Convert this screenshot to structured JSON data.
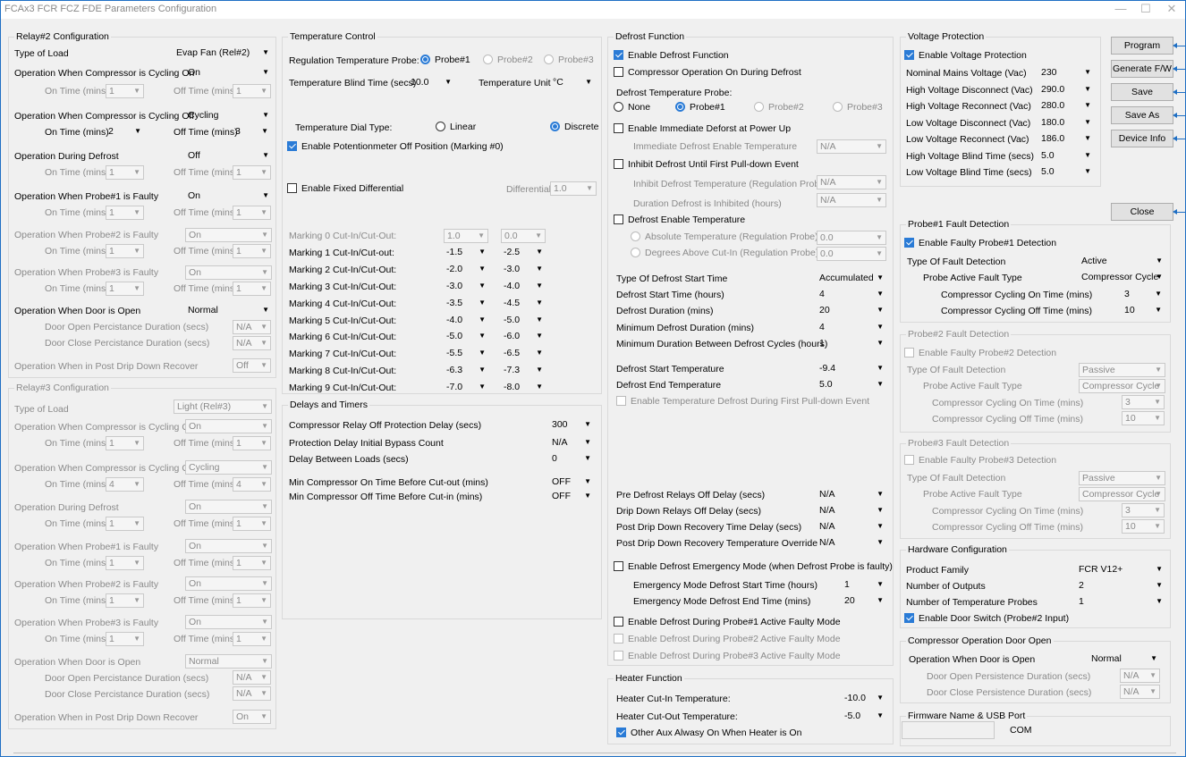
{
  "window": {
    "title": "FCAx3 FCR FCZ FDE Parameters Configuration",
    "min": "—",
    "max": "☐",
    "close": "✕"
  },
  "relay2": {
    "title": "Relay#2 Configuration",
    "type_label": "Type of Load",
    "type_value": "Evap Fan (Rel#2)",
    "cyc_on_label": "Operation When Compressor is Cycling On",
    "cyc_on_value": "On",
    "on_time": "On Time (mins)",
    "off_time": "Off Time (mins)",
    "one": "1",
    "two": "2",
    "three": "3",
    "cyc_off_label": "Operation When Compressor is Cycling Off",
    "cyc_off_value": "Cycling",
    "defrost_label": "Operation During Defrost",
    "defrost_value": "Off",
    "p1_label": "Operation When Probe#1 is Faulty",
    "p1_value": "On",
    "p2_label": "Operation When Probe#2 is Faulty",
    "p2_value": "On",
    "p3_label": "Operation When Probe#3 is Faulty",
    "p3_value": "On",
    "door_label": "Operation When Door is Open",
    "door_value": "Normal",
    "door_open_label": "Door Open Percistance Duration (secs)",
    "door_close_label": "Door Close Percistance Duration (secs)",
    "na": "N/A",
    "postdrip_label": "Operation When in Post Drip Down Recover",
    "postdrip_value": "Off"
  },
  "relay3": {
    "title": "Relay#3 Configuration",
    "type_label": "Type of Load",
    "type_value": "Light (Rel#3)",
    "cyc_on_label": "Operation When Compressor is Cycling On",
    "cyc_on_value": "On",
    "on_time": "On Time (mins)",
    "off_time": "Off Time (mins)",
    "one": "1",
    "four": "4",
    "cyc_off_label": "Operation When Compressor is Cycling Off",
    "cyc_off_value": "Cycling",
    "defrost_label": "Operation During Defrost",
    "defrost_value": "On",
    "p1_label": "Operation When Probe#1 is Faulty",
    "p1_value": "On",
    "p2_label": "Operation When Probe#2 is Faulty",
    "p2_value": "On",
    "p3_label": "Operation When Probe#3 is Faulty",
    "p3_value": "On",
    "door_label": "Operation When Door is Open",
    "door_value": "Normal",
    "door_open_label": "Door Open Percistance Duration (secs)",
    "door_close_label": "Door Close Percistance Duration (secs)",
    "na": "N/A",
    "postdrip_label": "Operation When in Post Drip Down Recover",
    "postdrip_value": "On"
  },
  "temp": {
    "title": "Temperature Control",
    "reg_probe_label": "Regulation Temperature Probe:",
    "probe1": "Probe#1",
    "probe2": "Probe#2",
    "probe3": "Probe#3",
    "blind_label": "Temperature Blind Time (secs)",
    "blind_value": "10.0",
    "unit_label": "Temperature Unit",
    "unit_value": "°C",
    "dial_label": "Temperature Dial Type:",
    "linear": "Linear",
    "discrete": "Discrete",
    "pot_label": "Enable Potentionmeter Off Position (Marking #0)",
    "fixed_label": "Enable Fixed Differential",
    "diff_label": "Differential",
    "diff_value": "1.0",
    "markings": [
      {
        "label": "Marking 0 Cut-In/Cut-Out:",
        "a": "1.0",
        "b": "0.0"
      },
      {
        "label": "Marking 1 Cut-In/Cut-out:",
        "a": "-1.5",
        "b": "-2.5"
      },
      {
        "label": "Marking 2 Cut-In/Cut-Out:",
        "a": "-2.0",
        "b": "-3.0"
      },
      {
        "label": "Marking 3 Cut-In/Cut-Out:",
        "a": "-3.0",
        "b": "-4.0"
      },
      {
        "label": "Marking 4 Cut-In/Cut-Out:",
        "a": "-3.5",
        "b": "-4.5"
      },
      {
        "label": "Marking 5 Cut-In/Cut-Out:",
        "a": "-4.0",
        "b": "-5.0"
      },
      {
        "label": "Marking 6 Cut-In/Cut-Out:",
        "a": "-5.0",
        "b": "-6.0"
      },
      {
        "label": "Marking 7 Cut-In/Cut-Out:",
        "a": "-5.5",
        "b": "-6.5"
      },
      {
        "label": "Marking 8 Cut-In/Cut-Out:",
        "a": "-6.3",
        "b": "-7.3"
      },
      {
        "label": "Marking 9 Cut-In/Cut-Out:",
        "a": "-7.0",
        "b": "-8.0"
      }
    ]
  },
  "delays": {
    "title": "Delays and Timers",
    "items": [
      {
        "label": "Compressor Relay Off Protection Delay (secs)",
        "value": "300"
      },
      {
        "label": "Protection Delay Initial Bypass Count",
        "value": "N/A"
      },
      {
        "label": "Delay Between Loads (secs)",
        "value": "0"
      },
      {
        "label": "Min Compressor On Time Before Cut-out (mins)",
        "value": "OFF"
      },
      {
        "label": "Min Compressor Off Time Before Cut-in (mins)",
        "value": "OFF"
      }
    ]
  },
  "defrost": {
    "title": "Defrost Function",
    "enable": "Enable Defrost Function",
    "comp_on": "Compressor Operation On During Defrost",
    "probe_label": "Defrost Temperature Probe:",
    "none": "None",
    "probe1": "Probe#1",
    "probe2": "Probe#2",
    "probe3": "Probe#3",
    "immediate": "Enable Immediate Deforst at Power Up",
    "immediate_temp": "Immediate Defrost Enable Temperature",
    "na": "N/A",
    "inhibit": "Inhibit Defrost Until First Pull-down Event",
    "inhibit_temp": "Inhibit Defrost Temperature (Regulation Probe)",
    "inhibit_dur": "Duration Defrost is Inhibited (hours)",
    "enable_temp": "Defrost Enable Temperature",
    "abs_temp": "Absolute Temperature (Regulation Probe)",
    "deg_above": "Degrees Above Cut-In (Regulation Probe)",
    "zero": "0.0",
    "start_type_label": "Type Of Defrost Start Time",
    "start_type_value": "Accumulated",
    "start_time_label": "Defrost Start Time (hours)",
    "start_time_value": "4",
    "duration_label": "Defrost Duration (mins)",
    "duration_value": "20",
    "min_dur_label": "Minimum Defrost Duration (mins)",
    "min_dur_value": "4",
    "min_between_label": "Minimum Duration Between Defrost Cycles (hours)",
    "min_between_value": "1",
    "start_temp_label": "Defrost Start Temperature",
    "start_temp_value": "-9.4",
    "end_temp_label": "Defrost End Temperature",
    "end_temp_value": "5.0",
    "first_pull": "Enable Temperature Defrost During First Pull-down Event",
    "pre_label": "Pre Defrost Relays Off Delay (secs)",
    "drip_label": "Drip Down Relays Off Delay (secs)",
    "post_delay_label": "Post Drip Down Recovery Time Delay (secs)",
    "post_override_label": "Post Drip Down Recovery Temperature Override",
    "emergency": "Enable Defrost Emergency Mode (when Defrost Probe is faulty)",
    "em_start_label": "Emergency Mode Defrost Start Time (hours)",
    "em_start_value": "1",
    "em_end_label": "Emergency Mode Defrost End Time (mins)",
    "em_end_value": "20",
    "dur_p1": "Enable Defrost During Probe#1 Active Faulty Mode",
    "dur_p2": "Enable Defrost During Probe#2 Active Faulty Mode",
    "dur_p3": "Enable Defrost During Probe#3 Active Faulty Mode"
  },
  "heater": {
    "title": "Heater Function",
    "cutin_label": "Heater Cut-In Temperature:",
    "cutin_value": "-10.0",
    "cutout_label": "Heater Cut-Out Temperature:",
    "cutout_value": "-5.0",
    "aux": "Other Aux Alwasy On When Heater is On"
  },
  "voltage": {
    "title": "Voltage Protection",
    "enable": "Enable Voltage Protection",
    "items": [
      {
        "label": "Nominal Mains Voltage (Vac)",
        "value": "230"
      },
      {
        "label": "High Voltage Disconnect (Vac)",
        "value": "290.0"
      },
      {
        "label": "High Voltage Reconnect (Vac)",
        "value": "280.0"
      },
      {
        "label": "Low Voltage Disconnect (Vac)",
        "value": "180.0"
      },
      {
        "label": "Low Voltage Reconnect (Vac)",
        "value": "186.0"
      },
      {
        "label": "High Voltage Blind Time (secs)",
        "value": "5.0"
      },
      {
        "label": "Low Voltage Blind Time (secs)",
        "value": "5.0"
      }
    ]
  },
  "buttons": {
    "program": "Program",
    "generate": "Generate F/W",
    "save": "Save",
    "save_as": "Save As",
    "device_info": "Device Info",
    "close": "Close"
  },
  "pf1": {
    "title": "Probe#1 Fault Detection",
    "enable": "Enable Faulty Probe#1 Detection",
    "type_label": "Type Of Fault Detection",
    "type_value": "Active",
    "active_label": "Probe Active Fault Type",
    "active_value": "Compressor Cycle",
    "on_label": "Compressor Cycling On Time (mins)",
    "on_value": "3",
    "off_label": "Compressor Cycling Off Time (mins)",
    "off_value": "10"
  },
  "pf2": {
    "title": "Probe#2 Fault Detection",
    "enable": "Enable Faulty Probe#2 Detection",
    "type_label": "Type Of Fault Detection",
    "type_value": "Passive",
    "active_label": "Probe Active Fault Type",
    "active_value": "Compressor Cycle",
    "on_label": "Compressor Cycling On Time (mins)",
    "on_value": "3",
    "off_label": "Compressor Cycling Off Time (mins)",
    "off_value": "10"
  },
  "pf3": {
    "title": "Probe#3 Fault Detection",
    "enable": "Enable Faulty Probe#3 Detection",
    "type_label": "Type Of Fault Detection",
    "type_value": "Passive",
    "active_label": "Probe Active Fault Type",
    "active_value": "Compressor Cycle",
    "on_label": "Compressor Cycling On Time (mins)",
    "on_value": "3",
    "off_label": "Compressor Cycling Off Time (mins)",
    "off_value": "10"
  },
  "hw": {
    "title": "Hardware Configuration",
    "family_label": "Product Family",
    "family_value": "FCR V12+",
    "outputs_label": "Number of Outputs",
    "outputs_value": "2",
    "probes_label": "Number of Temperature Probes",
    "probes_value": "1",
    "door": "Enable Door Switch (Probe#2 Input)"
  },
  "compdoor": {
    "title": "Compressor Operation Door Open",
    "op_label": "Operation When Door is Open",
    "op_value": "Normal",
    "open_label": "Door Open Persistence Duration (secs)",
    "close_label": "Door Close Persistence Duration (secs)",
    "na": "N/A"
  },
  "firmware": {
    "title": "Firmware Name & USB Port",
    "com": "COM"
  },
  "colors": {
    "accent": "#2a7bd6",
    "border": "#1f6fc4"
  }
}
